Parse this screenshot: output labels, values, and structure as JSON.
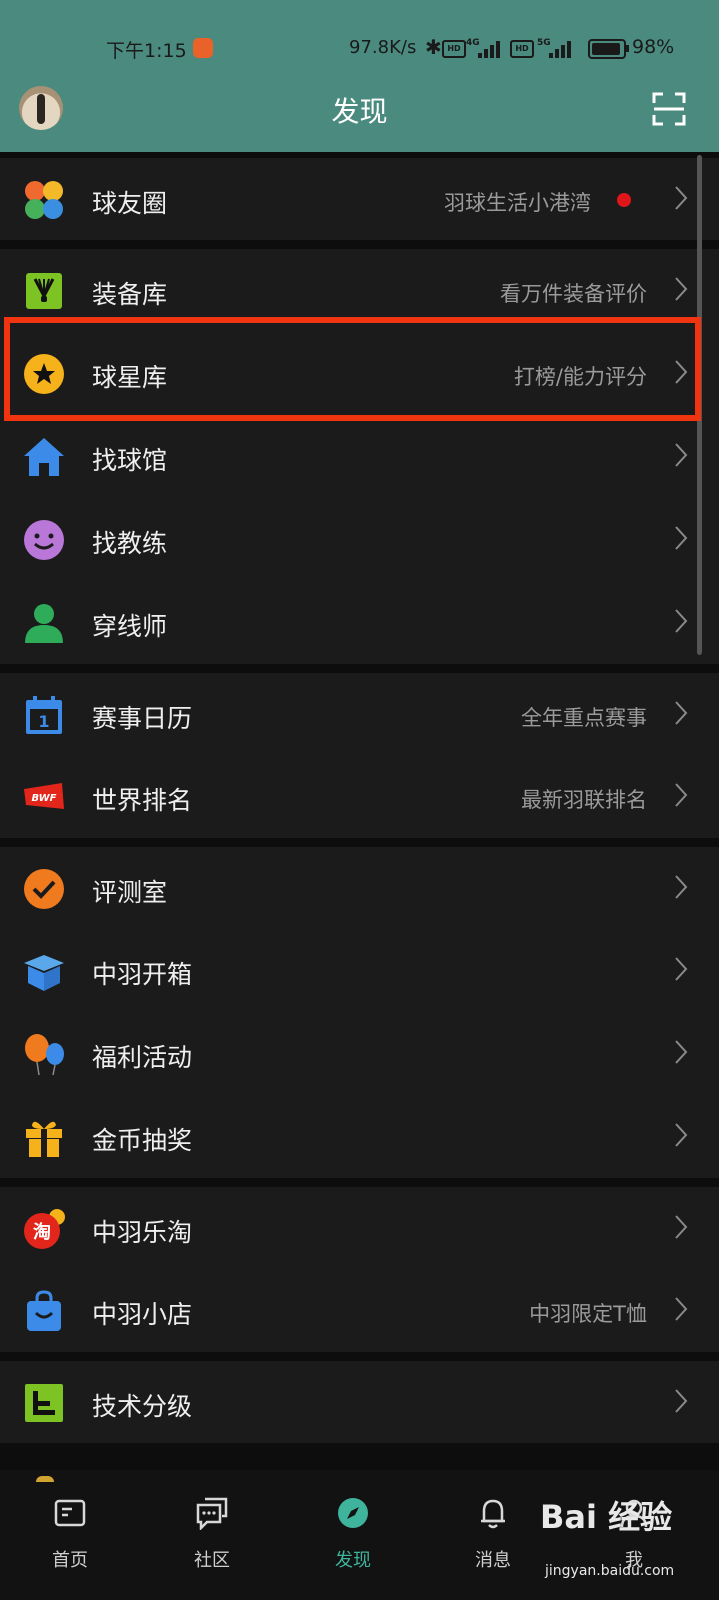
{
  "status_bar": {
    "time": "下午1:15",
    "network_speed": "97.8K/s",
    "sim1_label": "4G",
    "sim2_label": "5G",
    "hd_label": "HD",
    "battery": "98%"
  },
  "header": {
    "title": "发现"
  },
  "groups": [
    {
      "rows": [
        {
          "label": "球友圈",
          "sub": "羽球生活小港湾",
          "icon": "clover-icon",
          "has_dot": true
        }
      ]
    },
    {
      "rows": [
        {
          "label": "装备库",
          "sub": "看万件装备评价",
          "icon": "shuttlecock-icon"
        },
        {
          "label": "球星库",
          "sub": "打榜/能力评分",
          "icon": "star-icon"
        },
        {
          "label": "找球馆",
          "sub": "",
          "icon": "house-icon"
        },
        {
          "label": "找教练",
          "sub": "",
          "icon": "smiley-icon"
        },
        {
          "label": "穿线师",
          "sub": "",
          "icon": "person-icon"
        }
      ]
    },
    {
      "rows": [
        {
          "label": "赛事日历",
          "sub": "全年重点赛事",
          "icon": "calendar-icon",
          "icon_text": "1"
        },
        {
          "label": "世界排名",
          "sub": "最新羽联排名",
          "icon": "bwf-logo-icon",
          "icon_text": "BWF"
        }
      ]
    },
    {
      "rows": [
        {
          "label": "评测室",
          "sub": "",
          "icon": "check-circle-icon"
        },
        {
          "label": "中羽开箱",
          "sub": "",
          "icon": "box-icon"
        },
        {
          "label": "福利活动",
          "sub": "",
          "icon": "balloon-icon"
        },
        {
          "label": "金币抽奖",
          "sub": "",
          "icon": "gift-icon"
        }
      ]
    },
    {
      "rows": [
        {
          "label": "中羽乐淘",
          "sub": "",
          "icon": "tao-icon",
          "icon_text": "淘"
        },
        {
          "label": "中羽小店",
          "sub": "中羽限定T恤",
          "icon": "shopping-bag-icon"
        }
      ]
    },
    {
      "rows": [
        {
          "label": "技术分级",
          "sub": "",
          "icon": "level-icon"
        }
      ]
    }
  ],
  "bottom_nav": [
    {
      "label": "首页",
      "icon": "home-feed-icon"
    },
    {
      "label": "社区",
      "icon": "chat-icon"
    },
    {
      "label": "发现",
      "icon": "compass-icon",
      "active": true
    },
    {
      "label": "消息",
      "icon": "bell-icon"
    },
    {
      "label": "我",
      "icon": "user-icon"
    }
  ],
  "watermark": {
    "brand": "Bai 经验",
    "url": "jingyan.baidu.com"
  },
  "colors": {
    "header_bg": "#4b8a7e",
    "list_bg": "#1b1b1b",
    "highlight_border": "#f0340f",
    "active_tab": "#3fb39b"
  }
}
